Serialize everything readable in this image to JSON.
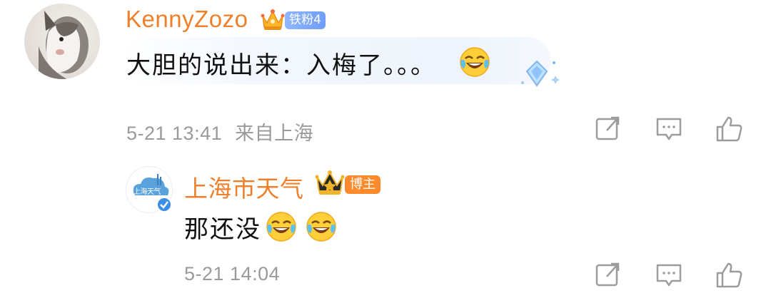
{
  "comments": [
    {
      "username": "KennyZozo",
      "badge": "铁粉4",
      "text": "大胆的说出来：入梅了。。。",
      "timestamp": "5-21 13:41",
      "location": "来自上海"
    },
    {
      "username": "上海市天气",
      "badge": "博主",
      "text": "那还没",
      "timestamp": "5-21 14:04"
    }
  ],
  "avatar_logo_text": "上海天气",
  "icons": {
    "share": "share-icon",
    "comment": "comment-icon",
    "like": "like-icon",
    "crown": "crown-icon",
    "laugh": "laugh-cry-emoji",
    "verified": "verified-icon"
  },
  "colors": {
    "username": "#f07f2a",
    "fans_badge": "#7aa6fa",
    "host_badge": "#ff8a2b",
    "meta": "#9a9a9a",
    "text": "#111111"
  }
}
